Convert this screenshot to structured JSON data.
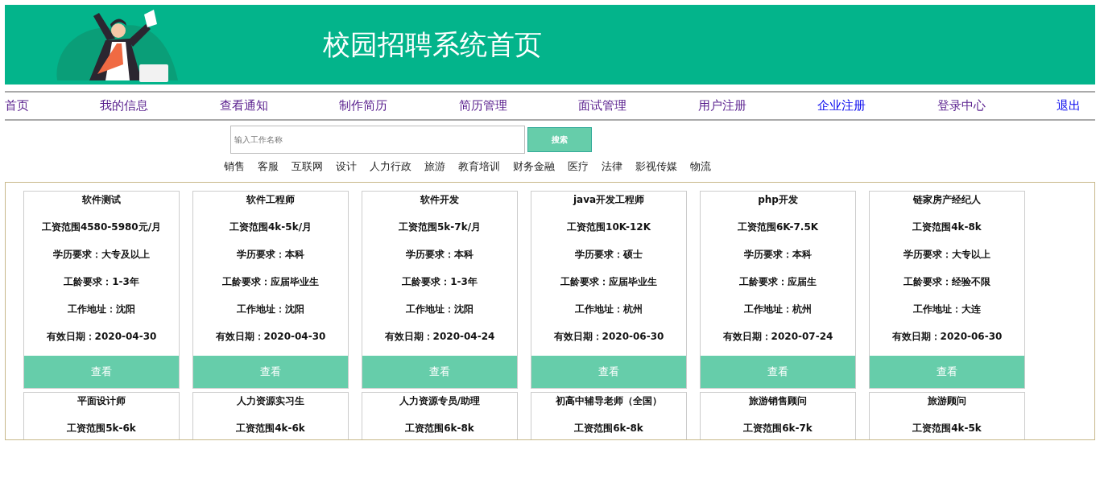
{
  "header": {
    "title": "校园招聘系统首页"
  },
  "nav": [
    {
      "label": "首页",
      "visited": true
    },
    {
      "label": "我的信息",
      "visited": true
    },
    {
      "label": "查看通知",
      "visited": true
    },
    {
      "label": "制作简历",
      "visited": true
    },
    {
      "label": "简历管理",
      "visited": true
    },
    {
      "label": "面试管理",
      "visited": true
    },
    {
      "label": "用户注册",
      "visited": true
    },
    {
      "label": "企业注册",
      "visited": false
    },
    {
      "label": "登录中心",
      "visited": true
    },
    {
      "label": "退出",
      "visited": false
    }
  ],
  "search": {
    "placeholder": "输入工作名称",
    "button": "搜索"
  },
  "categories": [
    "销售",
    "客服",
    "互联网",
    "设计",
    "人力行政",
    "旅游",
    "教育培训",
    "财务金融",
    "医疗",
    "法律",
    "影视传媒",
    "物流"
  ],
  "jobs": [
    {
      "title": "软件测试",
      "lines": [
        "工资范围4580-5980元/月",
        "学历要求：大专及以上",
        "工龄要求：1-3年",
        "工作地址：沈阳",
        "有效日期：2020-04-30"
      ],
      "button": "查看"
    },
    {
      "title": "软件工程师",
      "lines": [
        "工资范围4k-5k/月",
        "学历要求：本科",
        "工龄要求：应届毕业生",
        "工作地址：沈阳",
        "有效日期：2020-04-30"
      ],
      "button": "查看"
    },
    {
      "title": "软件开发",
      "lines": [
        "工资范围5k-7k/月",
        "学历要求：本科",
        "工龄要求：1-3年",
        "工作地址：沈阳",
        "有效日期：2020-04-24"
      ],
      "button": "查看"
    },
    {
      "title": "java开发工程师",
      "lines": [
        "工资范围10K-12K",
        "学历要求：硕士",
        "工龄要求：应届毕业生",
        "工作地址：杭州",
        "有效日期：2020-06-30"
      ],
      "button": "查看"
    },
    {
      "title": "php开发",
      "lines": [
        "工资范围6K-7.5K",
        "学历要求：本科",
        "工龄要求：应届生",
        "工作地址：杭州",
        "有效日期：2020-07-24"
      ],
      "button": "查看"
    },
    {
      "title": "链家房产经纪人",
      "lines": [
        "工资范围4k-8k",
        "学历要求：大专以上",
        "工龄要求：经验不限",
        "工作地址：大连",
        "有效日期：2020-06-30"
      ],
      "button": "查看"
    },
    {
      "title": "平面设计师",
      "lines": [
        "工资范围5k-6k"
      ]
    },
    {
      "title": "人力资源实习生",
      "lines": [
        "工资范围4k-6k"
      ]
    },
    {
      "title": "人力资源专员/助理",
      "lines": [
        "工资范围6k-8k"
      ]
    },
    {
      "title": "初高中辅导老师（全国）",
      "lines": [
        "工资范围6k-8k"
      ]
    },
    {
      "title": "旅游销售顾问",
      "lines": [
        "工资范围6k-7k"
      ]
    },
    {
      "title": "旅游顾问",
      "lines": [
        "工资范围4k-5k"
      ]
    }
  ]
}
